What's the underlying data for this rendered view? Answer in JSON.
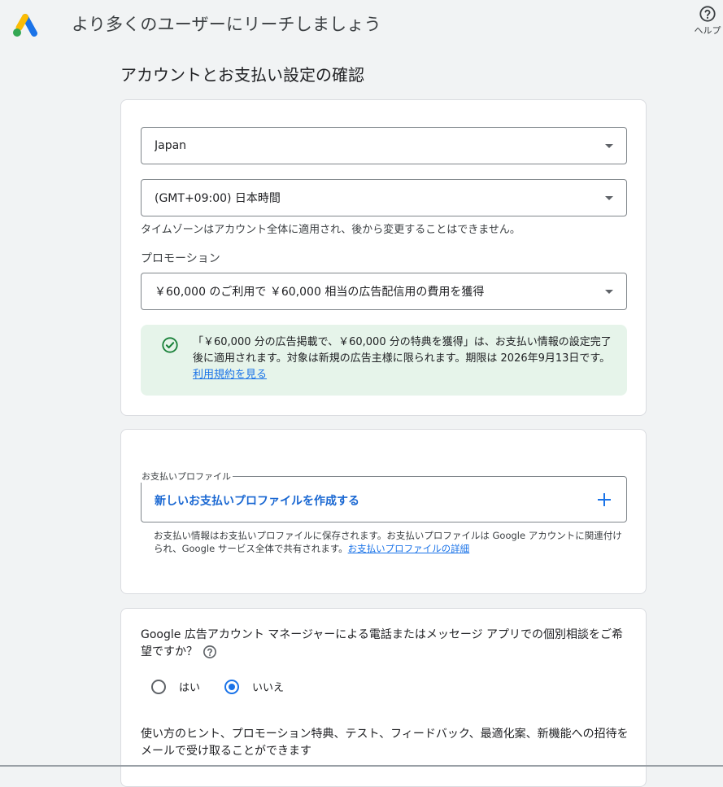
{
  "header": {
    "title": "より多くのユーザーにリーチしましょう",
    "help_label": "ヘルプ"
  },
  "page_title": "アカウントとお支払い設定の確認",
  "settings": {
    "country": "Japan",
    "timezone": "(GMT+09:00) 日本時間",
    "timezone_note": "タイムゾーンはアカウント全体に適用され、後から変更することはできません。",
    "promotion_label": "プロモーション",
    "promotion_value": "￥60,000 のご利用で ￥60,000 相当の広告配信用の費用を獲得",
    "promotion_message": "「￥60,000 分の広告掲載で、￥60,000 分の特典を獲得」は、お支払い情報の設定完了後に適用されます。対象は新規の広告主様に限られます。期限は 2026年9月13日です。",
    "promotion_terms_link": "利用規約を見る"
  },
  "payment": {
    "legend": "お支払いプロファイル",
    "create_label": "新しいお支払いプロファイルを作成する",
    "note": "お支払い情報はお支払いプロファイルに保存されます。お支払いプロファイルは Google アカウントに関連付けられ、Google サービス全体で共有されます。",
    "details_link": "お支払いプロファイルの詳細"
  },
  "consult": {
    "question": "Google 広告アカウント マネージャーによる電話またはメッセージ アプリでの個別相談をご希望ですか？",
    "yes_label": "はい",
    "no_label": "いいえ",
    "selected": "いいえ",
    "tips_text": "使い方のヒント、プロモーション特典、テスト、フィードバック、最適化案、新機能への招待をメールで受け取ることができます"
  },
  "colors": {
    "accent": "#1a73e8",
    "success_bg": "#e6f4ea",
    "success_icon": "#188038"
  },
  "icons": {
    "logo": "google-ads-logo",
    "help": "help-circle-icon",
    "check": "check-circle-icon",
    "plus": "plus-icon",
    "dropdown": "dropdown-arrow-icon"
  }
}
